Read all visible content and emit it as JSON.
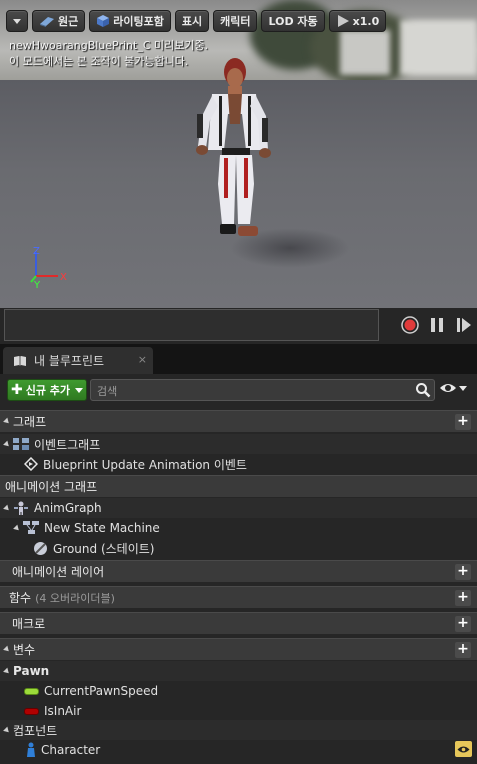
{
  "viewport": {
    "toolbar": {
      "perspective_label": "원근",
      "lighting_label": "라이팅포함",
      "show_label": "표시",
      "character_label": "캐릭터",
      "lod_label": "LOD 자동",
      "speed_label": "x1.0"
    },
    "message_line1": "newHwoarangBluePrint_C 미리보기중.",
    "message_line2": "이 모드에서는 본 조작이 불가능합니다.",
    "axis": {
      "x": "X",
      "y": "Y",
      "z": "Z"
    }
  },
  "tab": {
    "label": "내 블루프린트",
    "close": "×"
  },
  "toolbar": {
    "add_label": "신규 추가",
    "search_placeholder": "검색"
  },
  "sections": {
    "graph": {
      "label": "그래프",
      "event_graph": "이벤트그래프",
      "event_item": "Blueprint Update Animation 이벤트"
    },
    "anim_graph": {
      "label": "애니메이션 그래프",
      "anim_graph_item": "AnimGraph",
      "state_machine": "New State Machine",
      "state": "Ground (스테이트)"
    },
    "anim_layer": {
      "label": "애니메이션 레이어"
    },
    "functions": {
      "label": "함수",
      "count_note": "(4 오버라이더블)"
    },
    "macros": {
      "label": "매크로"
    },
    "variables": {
      "label": "변수",
      "pawn_category": "Pawn",
      "vars": [
        {
          "name": "CurrentPawnSpeed",
          "color": "#9cdb3a"
        },
        {
          "name": "IsInAir",
          "color": "#b00000"
        }
      ],
      "components_category": "컴포넌트",
      "component_item": "Character"
    }
  },
  "colors": {
    "accent_green": "#3a8f2b",
    "record_red": "#e03a3a"
  }
}
